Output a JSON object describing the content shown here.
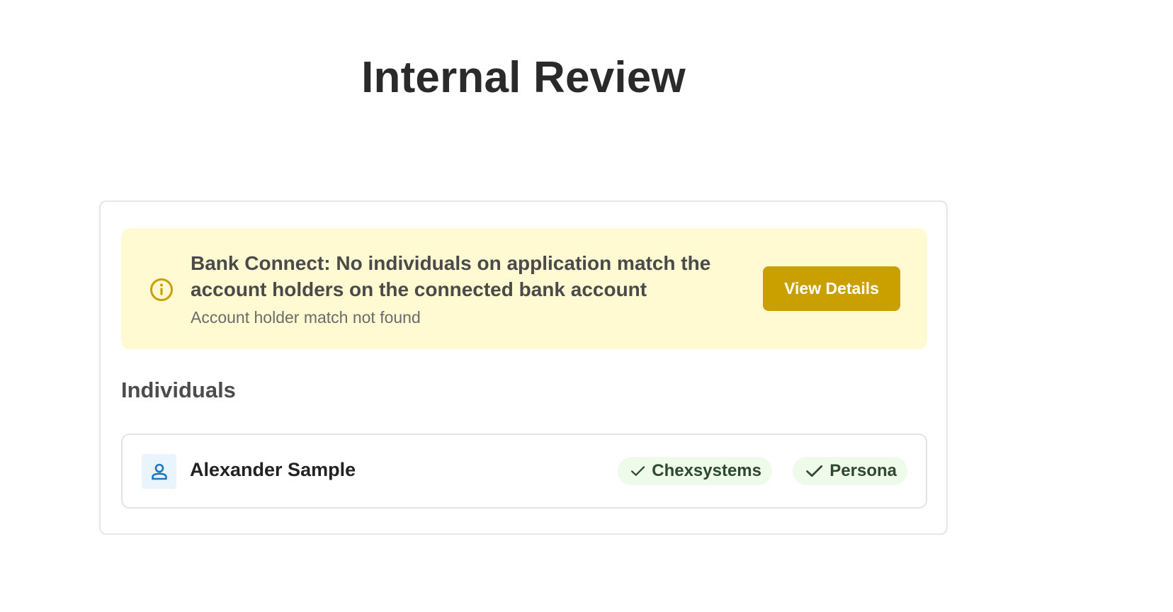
{
  "page": {
    "title": "Internal Review"
  },
  "alert": {
    "icon": "info-icon",
    "title": "Bank Connect: No individuals on application match the account holders on the connected bank account",
    "subtitle": "Account holder match not found",
    "action_label": "View Details",
    "colors": {
      "background": "#fffad2",
      "accent": "#c9a000"
    }
  },
  "individuals": {
    "heading": "Individuals",
    "items": [
      {
        "name": "Alexander Sample",
        "icon": "person-icon",
        "checks": [
          {
            "label": "Chexsystems",
            "status": "passed",
            "icon": "check-icon"
          },
          {
            "label": "Persona",
            "status": "passed",
            "icon": "check-icon"
          }
        ]
      }
    ]
  }
}
